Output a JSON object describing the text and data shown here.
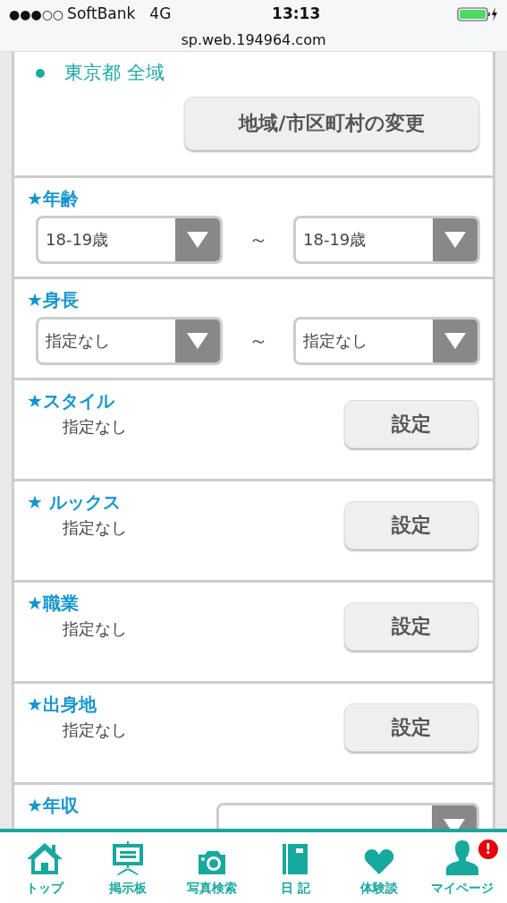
{
  "status_bar": {
    "signal": "●●●○○",
    "carrier": "SoftBank",
    "network": "4G",
    "time": "13:13"
  },
  "url": "sp.web.194964.com",
  "area": {
    "items": [
      "東京都 全域"
    ],
    "button": "地域/市区町村の変更"
  },
  "filters": [
    {
      "kind": "range",
      "title": "★年齢",
      "from": "18-19歳",
      "separator": "～",
      "to": "18-19歳"
    },
    {
      "kind": "range",
      "title": "★身長",
      "from": "指定なし",
      "separator": "～",
      "to": "指定なし"
    },
    {
      "kind": "setting",
      "title": "★スタイル",
      "value": "指定なし",
      "button": "設定"
    },
    {
      "kind": "setting",
      "title": "★ ルックス",
      "value": "指定なし",
      "button": "設定"
    },
    {
      "kind": "setting",
      "title": "★職業",
      "value": "指定なし",
      "button": "設定"
    },
    {
      "kind": "setting",
      "title": "★出身地",
      "value": "指定なし",
      "button": "設定"
    },
    {
      "kind": "select",
      "title": "★年収"
    }
  ],
  "nav": [
    {
      "kind": "home",
      "label": "トップ"
    },
    {
      "kind": "board",
      "label": "掲示板"
    },
    {
      "kind": "camera",
      "label": "写真検索"
    },
    {
      "kind": "book",
      "label": "日 記"
    },
    {
      "kind": "heart",
      "label": "体験談"
    },
    {
      "kind": "person",
      "label": "マイページ",
      "alert": "!"
    }
  ]
}
